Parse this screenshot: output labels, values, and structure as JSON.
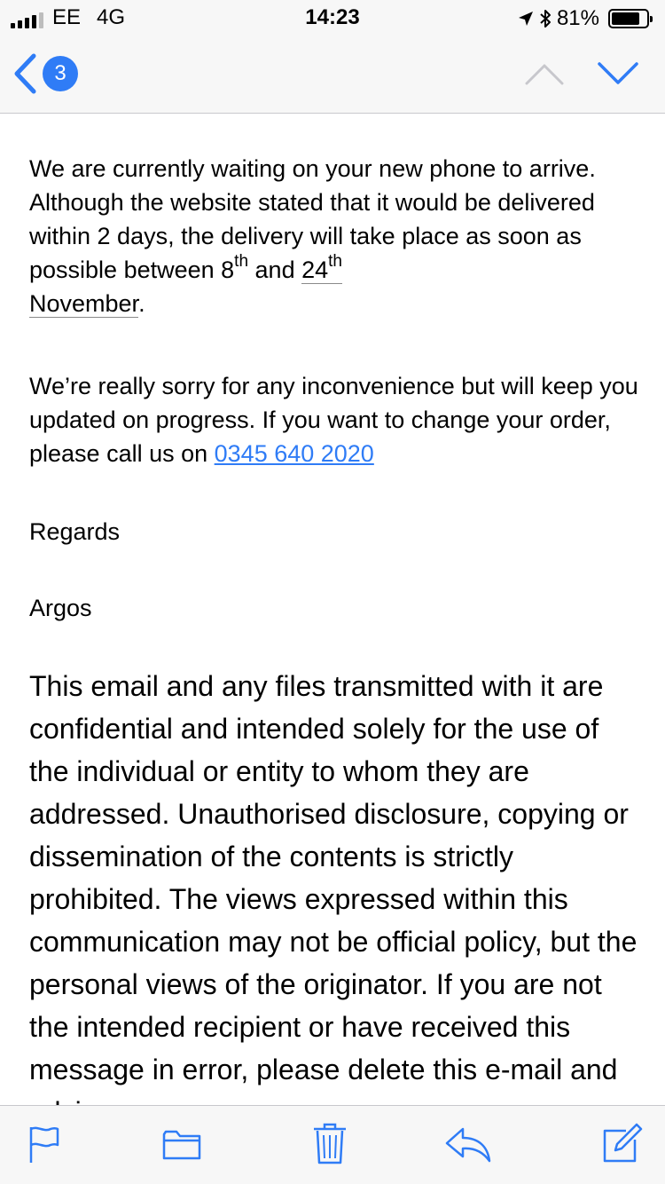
{
  "status_bar": {
    "carrier": "EE",
    "network": "4G",
    "time": "14:23",
    "battery_percent": "81%",
    "battery_level": 0.81,
    "signal_bars": 4,
    "icons": [
      "signal-icon",
      "location-arrow-icon",
      "bluetooth-icon",
      "battery-icon"
    ]
  },
  "nav": {
    "back_count": "3",
    "icons": [
      "back-chevron-icon",
      "previous-message-icon",
      "next-message-icon"
    ],
    "accent_color": "#2f7cf6",
    "disabled_color": "#c7c7cc"
  },
  "email": {
    "p1_text_a": "We are currently waiting on your new phone to arrive.  Although the website stated that it would be delivered within 2 days, the delivery will take place as soon as possible between 8",
    "p1_sup_1": "th",
    "p1_text_b": " and ",
    "p1_date_num": "24",
    "p1_sup_2": "th",
    "p1_month": "November",
    "p1_end": ".",
    "p2_text": "We’re really sorry for any inconvenience but will keep you updated on progress. If you want to change your order, please call us on ",
    "phone_link": "0345 640 2020",
    "regards": "Regards",
    "signature": "Argos",
    "disclaimer": "This email and any files transmitted with it are confidential and intended solely for the use of the individual or entity to whom they are addressed. Unauthorised disclosure, copying or dissemination of the contents is strictly prohibited. The views expressed within this communication may not be official policy, but the personal views of the originator. If you are not the intended recipient or have received this message in error, please delete this e-mail and advise"
  },
  "toolbar": {
    "icons": [
      "flag-icon",
      "folder-icon",
      "trash-icon",
      "reply-icon",
      "compose-icon"
    ]
  }
}
